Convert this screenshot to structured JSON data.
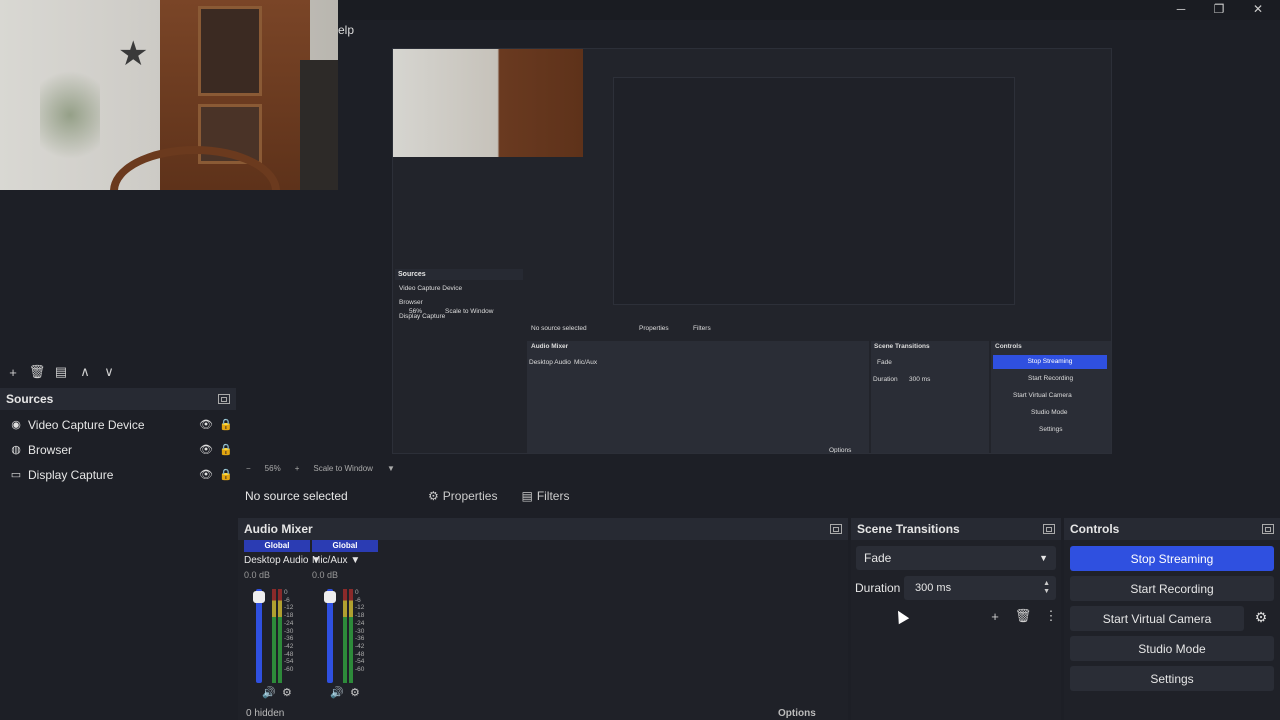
{
  "window": {
    "menu_fragment": "elp",
    "controls": [
      "─",
      "❐",
      "✕"
    ]
  },
  "sources": {
    "title": "Sources",
    "toolbar": [
      "+",
      "🗑",
      "▤",
      "∧",
      "∨"
    ],
    "items": [
      {
        "icon": "camera-icon",
        "glyph": "◉",
        "label": "Video Capture Device"
      },
      {
        "icon": "browser-icon",
        "glyph": "◍",
        "label": "Browser"
      },
      {
        "icon": "display-icon",
        "glyph": "▭",
        "label": "Display Capture"
      }
    ]
  },
  "preview": {
    "zoom": "56%",
    "scale_mode": "Scale to Window"
  },
  "context_bar": {
    "status": "No source selected",
    "properties": "Properties",
    "filters": "Filters"
  },
  "audio_mixer": {
    "title": "Audio Mixer",
    "channels": [
      {
        "tag": "Global",
        "name": "Desktop Audio",
        "db": "0.0 dB"
      },
      {
        "tag": "Global",
        "name": "Mic/Aux",
        "db": "0.0 dB"
      }
    ],
    "scale": [
      "0",
      "-6",
      "-12",
      "-18",
      "-24",
      "-30",
      "-36",
      "-42",
      "-48",
      "-54",
      "-60"
    ],
    "hidden": "0 hidden",
    "options": "Options"
  },
  "scene_transitions": {
    "title": "Scene Transitions",
    "transition": "Fade",
    "duration_label": "Duration",
    "duration_value": "300 ms"
  },
  "controls": {
    "title": "Controls",
    "stop_streaming": "Stop Streaming",
    "start_recording": "Start Recording",
    "start_virtual_camera": "Start Virtual Camera",
    "studio_mode": "Studio Mode",
    "settings": "Settings"
  },
  "nested_preview": {
    "sources_title": "Sources",
    "items": [
      "Video Capture Device",
      "Browser",
      "Display Capture"
    ],
    "no_source": "No source selected",
    "properties": "Properties",
    "filters": "Filters",
    "audio_mixer": "Audio Mixer",
    "scene_transitions": "Scene Transitions",
    "controls": "Controls",
    "fade": "Fade",
    "duration": "Duration",
    "duration_value": "300 ms",
    "stop_streaming": "Stop Streaming",
    "start_recording": "Start Recording",
    "start_virtual_camera": "Start Virtual Camera",
    "studio_mode": "Studio Mode",
    "settings": "Settings",
    "zoom": "56%",
    "scale_mode": "Scale to Window",
    "desktop_audio": "Desktop Audio",
    "mic_aux": "Mic/Aux",
    "options": "Options"
  },
  "colors": {
    "accent": "#2f50e0",
    "panel": "#1f2128",
    "background": "#1d1f26"
  }
}
